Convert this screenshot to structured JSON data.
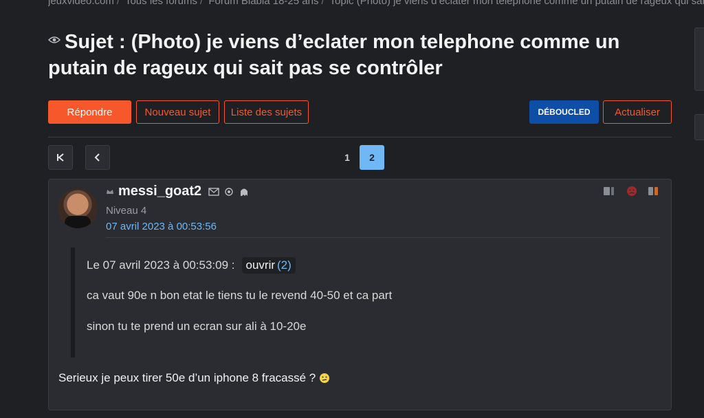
{
  "breadcrumb": {
    "site": "jeuxvideo.com",
    "forums": "Tous les forums",
    "forum": "Forum Blabla 18-25 ans",
    "topic": "Topic (Photo) je viens d’eclater mon telephone comme un putain de rageux qui sait pas se contrôler"
  },
  "topic": {
    "title": "Sujet : (Photo) je viens d’eclater mon telephone comme un putain de rageux qui sait pas se contrôler"
  },
  "toolbar": {
    "reply_label": "Répondre",
    "new_topic_label": "Nouveau sujet",
    "topic_list_label": "Liste des sujets",
    "deboucled_label": "DÉBOUCLED",
    "refresh_label": "Actualiser"
  },
  "pagination": {
    "pages": [
      "1",
      "2"
    ],
    "current": "2"
  },
  "post": {
    "author": "messi_goat2",
    "level": "Niveau 4",
    "date": "07 avril 2023 à 00:53:56",
    "quote": {
      "header": "Le 07 avril 2023 à 00:53:09 :",
      "open_label": "ouvrir",
      "open_count": "(2)",
      "lines": [
        "ca vaut 90e n bon etat le tiens tu le revend 40-50 et ca part",
        "sinon tu te prend un ecran sur ali à 10-20e"
      ]
    },
    "body": "Serieux je peux tirer 50e d’un iphone 8 fracassé ?"
  },
  "colors": {
    "accent": "#f6582b",
    "link": "#6fb7f5",
    "deboucled": "#0f4ea6",
    "background": "#1f2024",
    "panel": "#2a2c31"
  }
}
